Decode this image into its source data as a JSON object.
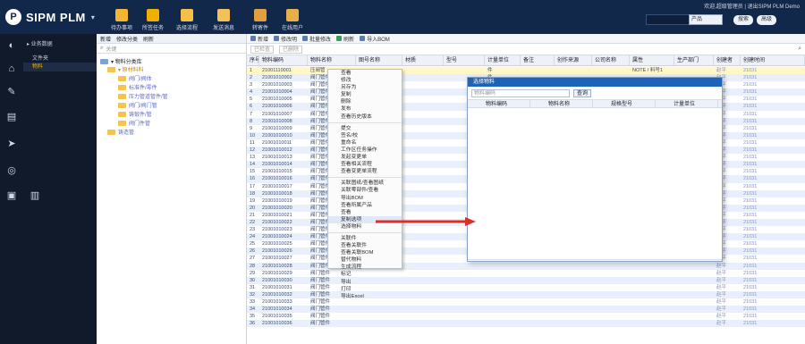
{
  "app": {
    "name": "SIPM PLM",
    "welcome": "欢迎,超级管理员 | 退出SIPM PLM Demo"
  },
  "top_buttons": [
    {
      "label": "待办事项",
      "color": "#f2b632"
    },
    {
      "label": "所签任务",
      "color": "#f0b000"
    },
    {
      "label": "选择流程",
      "color": "#f5c04a"
    },
    {
      "label": "发送消息",
      "color": "#f2c15a"
    },
    {
      "label": "转寄件",
      "color": "#e0a040"
    },
    {
      "label": "在线用户",
      "color": "#e6b04a"
    }
  ],
  "header_search": {
    "select": "产品",
    "search_btn": "搜索",
    "advanced_btn": "高级"
  },
  "menu": {
    "section": "▸ 业务数据",
    "group": "文件夹",
    "selected": "物料"
  },
  "tree": {
    "toolbar": {
      "new": "新增",
      "edit": "修改分类",
      "refresh": "刷新"
    },
    "search_placeholder": "关键",
    "nodes": [
      "▾ 物料分类库",
      "▾ 原材料料",
      "阀门/阀体",
      "标准件/零件",
      "压力管道管件/管",
      "阀门/阀门管",
      "铸锻件/管",
      "阀门件管",
      "铸造管"
    ]
  },
  "grid": {
    "toolbar": [
      "新增",
      "修改明",
      "批量修改",
      "刷新",
      "导入BOM"
    ],
    "filter_buttons": [
      "已检查",
      "已删除"
    ],
    "columns": [
      "序号",
      "物料编码",
      "物料名称",
      "图号名称",
      "材质",
      "型号",
      "计量单位",
      "备注",
      "创作来源",
      "公司名称",
      "属性",
      "生产部门",
      "创建者",
      "创建时间"
    ],
    "rows": [
      [
        "1",
        "21001110001",
        "压阀管",
        "",
        "",
        "",
        "件",
        "",
        "",
        "",
        "NOTE / 料号1",
        "",
        "赵平",
        "21031"
      ],
      [
        "2",
        "21001010002",
        "阀门管件",
        "",
        "",
        "",
        "件",
        "",
        "",
        "",
        "",
        "",
        "赵平",
        "21031"
      ],
      [
        "3",
        "21001010003",
        "阀门管件",
        "",
        "",
        "",
        "",
        "",
        "",
        "",
        "",
        "",
        "赵平",
        "21031"
      ],
      [
        "4",
        "21001010004",
        "阀门管件",
        "",
        "",
        "",
        "",
        "",
        "",
        "",
        "",
        "",
        "赵平",
        "21031"
      ],
      [
        "5",
        "21001010005",
        "阀门管件",
        "",
        "",
        "",
        "",
        "",
        "",
        "",
        "",
        "",
        "赵平",
        "21031"
      ],
      [
        "6",
        "21001010006",
        "阀门管件",
        "",
        "",
        "",
        "",
        "",
        "",
        "",
        "",
        "",
        "赵平",
        "21031"
      ],
      [
        "7",
        "21001010007",
        "阀门管件",
        "",
        "",
        "",
        "",
        "",
        "",
        "",
        "",
        "",
        "赵平",
        "21031"
      ],
      [
        "8",
        "21001010008",
        "阀门管件",
        "",
        "",
        "",
        "",
        "",
        "",
        "",
        "",
        "",
        "赵平",
        "21031"
      ],
      [
        "9",
        "21001010009",
        "阀门管件",
        "",
        "",
        "",
        "",
        "",
        "",
        "",
        "",
        "",
        "赵平",
        "21031"
      ],
      [
        "10",
        "21001010010",
        "阀门管件",
        "",
        "",
        "",
        "",
        "",
        "",
        "",
        "",
        "",
        "赵平",
        "21031"
      ],
      [
        "11",
        "21001010011",
        "阀门管件",
        "",
        "",
        "",
        "",
        "",
        "",
        "",
        "",
        "",
        "赵平",
        "21031"
      ],
      [
        "12",
        "21001010012",
        "阀门管件",
        "",
        "",
        "",
        "",
        "",
        "",
        "",
        "",
        "",
        "赵平",
        "21031"
      ],
      [
        "13",
        "21001010013",
        "阀门管件",
        "",
        "",
        "",
        "",
        "",
        "",
        "",
        "",
        "",
        "赵平",
        "21031"
      ],
      [
        "14",
        "21001010014",
        "阀门管件",
        "",
        "",
        "",
        "",
        "",
        "",
        "",
        "",
        "",
        "赵平",
        "21031"
      ],
      [
        "15",
        "21001010015",
        "阀门管件",
        "",
        "",
        "",
        "",
        "",
        "",
        "",
        "",
        "",
        "赵平",
        "21031"
      ],
      [
        "16",
        "21001010016",
        "阀门管件",
        "",
        "",
        "",
        "",
        "",
        "",
        "",
        "",
        "",
        "赵平",
        "21031"
      ],
      [
        "17",
        "21001010017",
        "阀门管件",
        "",
        "",
        "",
        "",
        "",
        "",
        "",
        "",
        "",
        "赵平",
        "21031"
      ],
      [
        "18",
        "21001010018",
        "阀门管件",
        "",
        "",
        "",
        "",
        "",
        "",
        "",
        "",
        "",
        "赵平",
        "21031"
      ],
      [
        "19",
        "21001010019",
        "阀门管件",
        "",
        "",
        "",
        "",
        "",
        "",
        "",
        "",
        "",
        "赵平",
        "21031"
      ],
      [
        "20",
        "21001010020",
        "阀门管件",
        "",
        "",
        "",
        "",
        "",
        "",
        "",
        "",
        "",
        "赵平",
        "21031"
      ],
      [
        "21",
        "21001010021",
        "阀门管件",
        "",
        "",
        "",
        "",
        "",
        "",
        "",
        "",
        "",
        "赵平",
        "21031"
      ],
      [
        "22",
        "21001010022",
        "阀门管件",
        "",
        "",
        "",
        "",
        "",
        "",
        "",
        "",
        "",
        "赵平",
        "21031"
      ],
      [
        "23",
        "21001010023",
        "阀门管件",
        "",
        "",
        "",
        "",
        "",
        "",
        "",
        "",
        "",
        "赵平",
        "21031"
      ],
      [
        "24",
        "21001010024",
        "阀门管件",
        "",
        "",
        "",
        "",
        "",
        "",
        "",
        "",
        "",
        "赵平",
        "21031"
      ],
      [
        "25",
        "21001010025",
        "阀门管件",
        "",
        "",
        "",
        "",
        "",
        "",
        "",
        "",
        "",
        "赵平",
        "21031"
      ],
      [
        "26",
        "21001010026",
        "阀门管件",
        "",
        "",
        "",
        "",
        "",
        "",
        "",
        "",
        "",
        "赵平",
        "21031"
      ],
      [
        "27",
        "21001010027",
        "阀门管件",
        "",
        "",
        "",
        "",
        "",
        "",
        "",
        "",
        "",
        "赵平",
        "21031"
      ],
      [
        "28",
        "21001010028",
        "阀门管件",
        "",
        "",
        "",
        "",
        "",
        "",
        "",
        "",
        "",
        "赵平",
        "21031"
      ],
      [
        "29",
        "21001010029",
        "阀门管件",
        "",
        "",
        "",
        "",
        "",
        "",
        "",
        "",
        "",
        "赵平",
        "21031"
      ],
      [
        "30",
        "21001010030",
        "阀门管件",
        "",
        "",
        "",
        "",
        "",
        "",
        "",
        "",
        "",
        "赵平",
        "21031"
      ],
      [
        "31",
        "21001010031",
        "阀门管件",
        "",
        "",
        "",
        "",
        "",
        "",
        "",
        "",
        "",
        "赵平",
        "21031"
      ],
      [
        "32",
        "21001010032",
        "阀门管件",
        "",
        "",
        "",
        "",
        "",
        "",
        "",
        "",
        "",
        "赵平",
        "21031"
      ],
      [
        "33",
        "21001010033",
        "阀门管件",
        "",
        "",
        "",
        "",
        "",
        "",
        "",
        "",
        "",
        "赵平",
        "21031"
      ],
      [
        "34",
        "21001010034",
        "阀门管件",
        "",
        "",
        "",
        "",
        "",
        "",
        "",
        "",
        "",
        "赵平",
        "21031"
      ],
      [
        "35",
        "21001010035",
        "阀门管件",
        "",
        "",
        "",
        "",
        "",
        "",
        "",
        "",
        "",
        "赵平",
        "21031"
      ],
      [
        "36",
        "21001010036",
        "阀门管件",
        "",
        "",
        "",
        "",
        "",
        "",
        "",
        "",
        "",
        "赵平",
        "21031"
      ]
    ]
  },
  "context_menu": {
    "items": [
      "查看",
      "修改",
      "另存为",
      "复制",
      "删除",
      "发布",
      "查看历史版本",
      "-",
      "提交",
      "签名/校",
      "重命名",
      "工作区任务操作",
      "发起变更单",
      "查看相关流程",
      "查看变更单流程",
      "-",
      "关联图纸/查看图纸",
      "关联零部件/查看",
      "导出BOM",
      "查看所属产品",
      "查看",
      "复制选项",
      "选择物料",
      "-",
      "关联件",
      "查看关联件",
      "查看关联BOM",
      "替代物料",
      "生成流程",
      "标记",
      "导出",
      "打印",
      "导出Excel"
    ],
    "active_index": 21
  },
  "dialog": {
    "title": "选择物料",
    "search_placeholder": "物料编码",
    "search_btn": "查询",
    "columns": [
      "物料编码",
      "物料名称",
      "规格型号",
      "计量单位"
    ]
  }
}
